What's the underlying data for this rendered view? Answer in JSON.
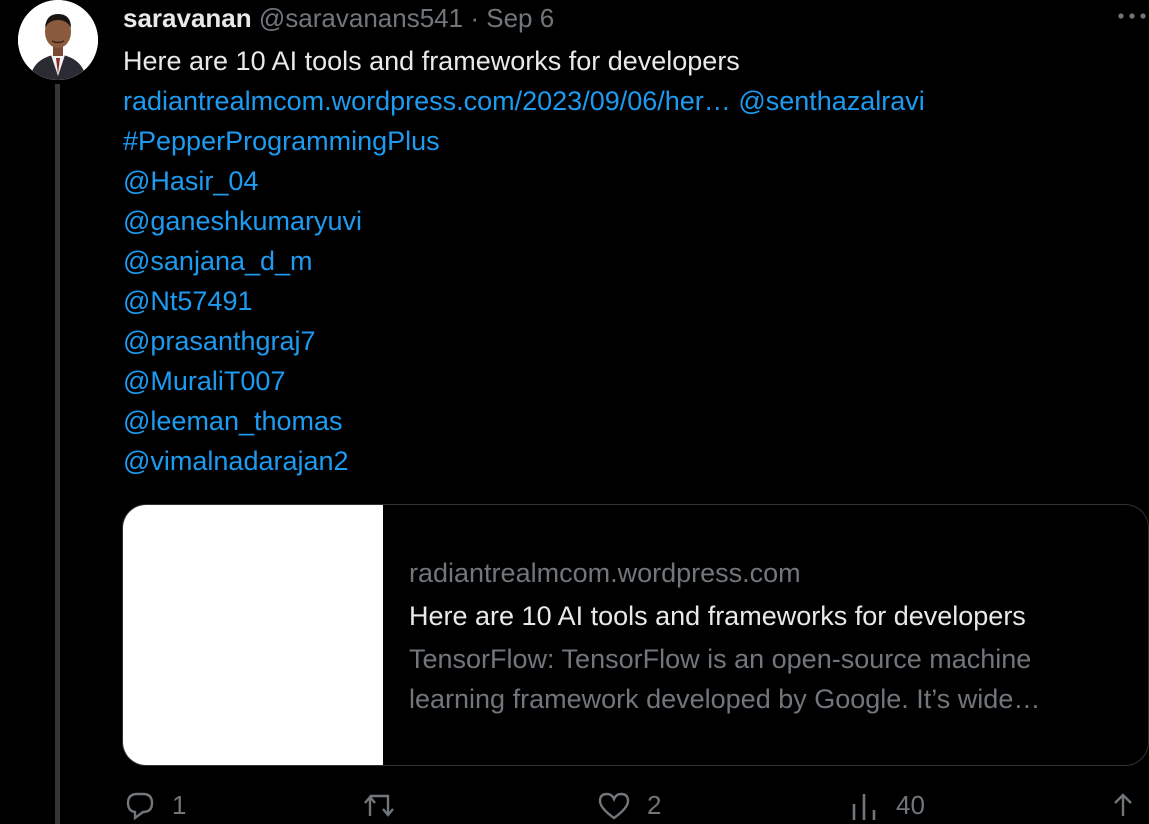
{
  "tweet": {
    "author": {
      "name": "saravanan",
      "handle": "@saravanans541",
      "separator": "·",
      "date": "Sep 6"
    },
    "more_icon": "more-horizontal-icon",
    "text": "Here are 10 AI tools and frameworks for developers",
    "url": "radiantrealmcom.wordpress.com/2023/09/06/her…",
    "mention_first": "@senthazalravi",
    "hashtag": "#PepperProgrammingPlus",
    "mentions": [
      "@Hasir_04",
      "@ganeshkumaryuvi",
      "@sanjana_d_m",
      "@Nt57491",
      "@prasanthgraj7",
      "@MuraliT007",
      "@leeman_thomas",
      "@vimalnadarajan2"
    ]
  },
  "card": {
    "domain": "radiantrealmcom.wordpress.com",
    "title": "Here are 10 AI tools and frameworks for developers",
    "description_line1": "TensorFlow: TensorFlow is an open-source machine",
    "description_line2": "learning framework developed by Google. It’s wide…"
  },
  "actions": {
    "reply": {
      "icon": "reply-icon",
      "count": "1"
    },
    "retweet": {
      "icon": "retweet-icon",
      "count": ""
    },
    "like": {
      "icon": "heart-icon",
      "count": "2"
    },
    "views": {
      "icon": "views-icon",
      "count": "40"
    },
    "share": {
      "icon": "share-icon"
    }
  },
  "colors": {
    "background": "#000000",
    "text": "#e7e9ea",
    "secondary": "#71767b",
    "link": "#1d9bf0",
    "border": "#2f3336"
  }
}
